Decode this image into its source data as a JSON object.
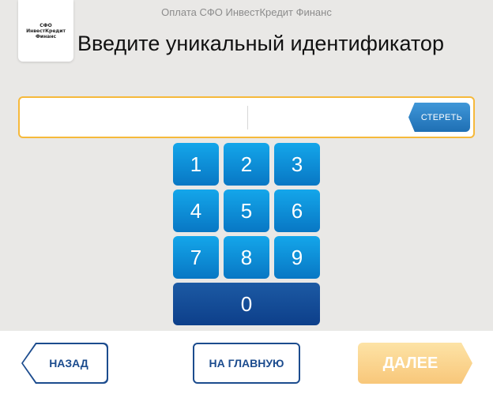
{
  "header": {
    "logo_text": "СФО\nИнвестКредит\nФинанс",
    "org_title": "Оплата СФО ИнвестКредит Финанс",
    "page_title": "Введите уникальный идентификатор"
  },
  "input": {
    "value": "",
    "clear_label": "СТЕРЕТЬ"
  },
  "keypad": {
    "keys": [
      "1",
      "2",
      "3",
      "4",
      "5",
      "6",
      "7",
      "8",
      "9",
      "0"
    ]
  },
  "footer": {
    "back_label": "НАЗАД",
    "home_label": "НА ГЛАВНУЮ",
    "next_label": "ДАЛЕЕ",
    "next_enabled": false
  },
  "colors": {
    "background": "#e9e8e6",
    "key_blue": "#0f90d8",
    "key_zero": "#154c96",
    "accent_orange": "#f6b93b",
    "nav_border": "#1c4c8e",
    "next_disabled": "#f8cf86"
  }
}
